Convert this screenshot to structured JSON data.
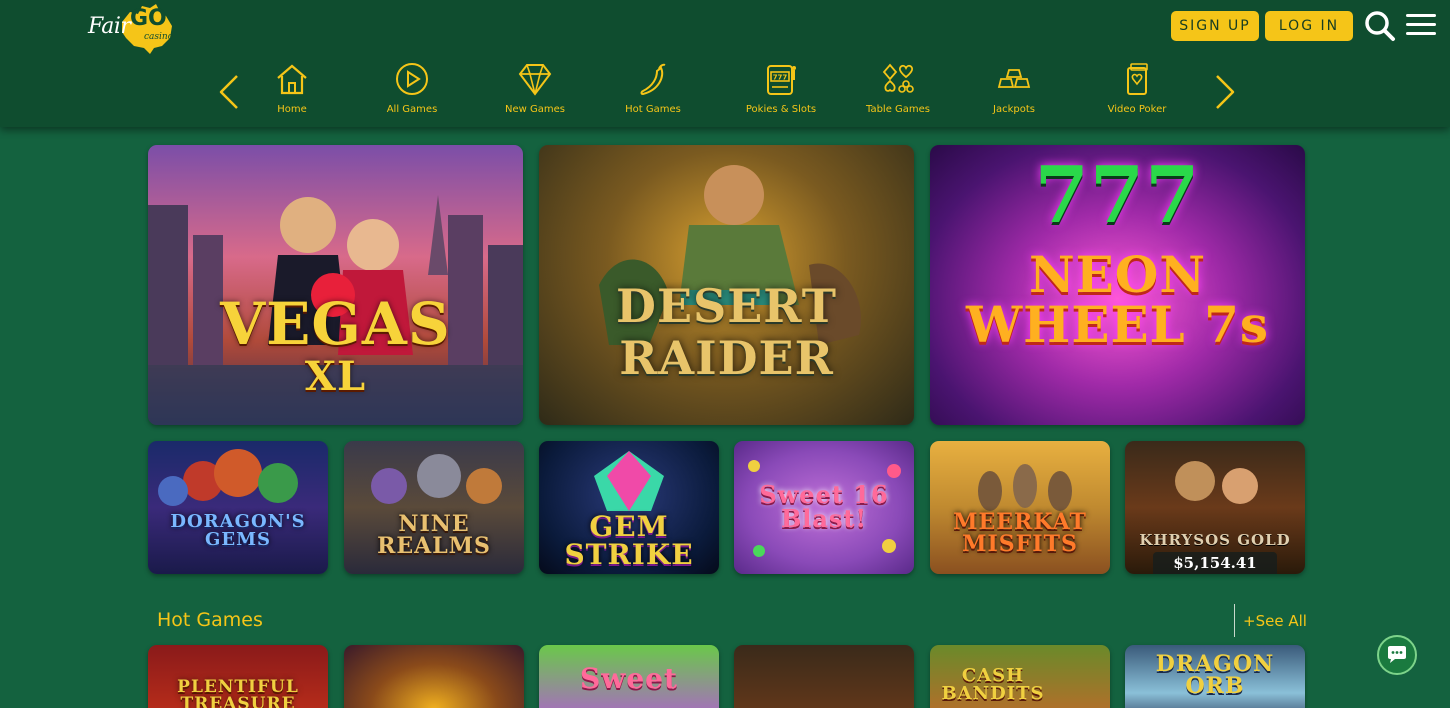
{
  "header": {
    "logo_text": "Fair",
    "logo_go": "GO",
    "logo_sub": "casino",
    "signup_label": "SIGN UP",
    "login_label": "LOG IN"
  },
  "nav": {
    "items": [
      {
        "label": "Home",
        "icon": "home-icon"
      },
      {
        "label": "All Games",
        "icon": "play-icon"
      },
      {
        "label": "New Games",
        "icon": "diamond-icon"
      },
      {
        "label": "Hot Games",
        "icon": "chili-icon"
      },
      {
        "label": "Pokies & Slots",
        "icon": "slot-machine-icon"
      },
      {
        "label": "Table Games",
        "icon": "card-suits-icon"
      },
      {
        "label": "Jackpots",
        "icon": "gold-bars-icon"
      },
      {
        "label": "Video Poker",
        "icon": "video-poker-icon"
      }
    ]
  },
  "featured": [
    {
      "title_line1": "VEGAS",
      "title_line2": "XL"
    },
    {
      "title_line1": "DESERT",
      "title_line2": "RAIDER"
    },
    {
      "title_line1": "777",
      "title_line2": "NEON WHEEL 7s"
    }
  ],
  "games": [
    {
      "title": "DORAGON'S GEMS"
    },
    {
      "title": "NINE REALMS"
    },
    {
      "title": "GEM STRIKE"
    },
    {
      "title": "Sweet 16 Blast!"
    },
    {
      "title": "MEERKAT MISFITS"
    },
    {
      "title": "KHRYSOS GOLD",
      "jackpot": "$5,154.41"
    }
  ],
  "hot_section": {
    "title": "Hot Games",
    "see_all": "+See All",
    "games": [
      {
        "title": "PLENTIFUL TREASURE"
      },
      {
        "title": ""
      },
      {
        "title": "Sweet"
      },
      {
        "title": ""
      },
      {
        "title": "CASH BANDITS"
      },
      {
        "title": "DRAGON ORB"
      }
    ]
  },
  "colors": {
    "background": "#14623f",
    "header": "#0f4d2f",
    "accent": "#f5c518"
  }
}
